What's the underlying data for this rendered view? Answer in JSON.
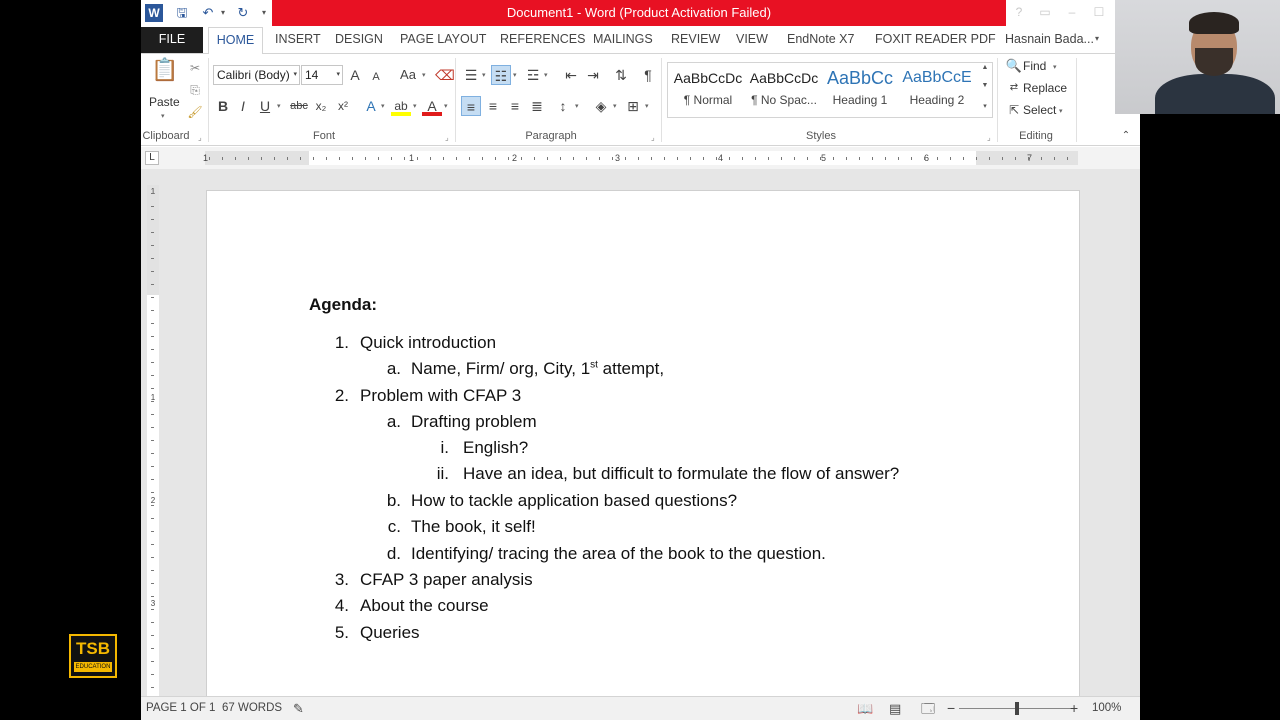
{
  "window": {
    "title": "Document1 -  Word (Product Activation Failed)",
    "help": "?",
    "user_name": "Hasnain Bada..."
  },
  "tabs": [
    {
      "label": "FILE"
    },
    {
      "label": "HOME"
    },
    {
      "label": "INSERT"
    },
    {
      "label": "DESIGN"
    },
    {
      "label": "PAGE LAYOUT"
    },
    {
      "label": "REFERENCES"
    },
    {
      "label": "MAILINGS"
    },
    {
      "label": "REVIEW"
    },
    {
      "label": "VIEW"
    },
    {
      "label": "EndNote X7"
    },
    {
      "label": "FOXIT READER PDF"
    }
  ],
  "ribbon": {
    "clipboard": {
      "paste": "Paste",
      "label": "Clipboard"
    },
    "font": {
      "family": "Calibri (Body)",
      "size": "14",
      "bold": "B",
      "italic": "I",
      "underline": "U",
      "strike": "abc",
      "subscript": "x₂",
      "superscript": "x²",
      "grow": "A",
      "shrink": "A",
      "case": "Aa",
      "label": "Font"
    },
    "paragraph": {
      "label": "Paragraph",
      "pilcrow": "¶"
    },
    "styles": {
      "label": "Styles",
      "items": [
        {
          "sample": "AaBbCcDc",
          "name": "¶ Normal"
        },
        {
          "sample": "AaBbCcDc",
          "name": "¶ No Spac..."
        },
        {
          "sample": "AaBbCc",
          "name": "Heading 1"
        },
        {
          "sample": "AaBbCcE",
          "name": "Heading 2"
        }
      ]
    },
    "editing": {
      "find": "Find",
      "replace": "Replace",
      "select": "Select",
      "label": "Editing"
    }
  },
  "ruler": {
    "numbers": [
      "1",
      "1",
      "2",
      "3",
      "4",
      "5",
      "6",
      "7"
    ]
  },
  "vruler": {
    "numbers": [
      "1",
      "1",
      "2",
      "3"
    ]
  },
  "document": {
    "heading": "Agenda:",
    "lines": [
      {
        "num": "1.",
        "text": "Quick introduction"
      },
      {
        "num": "a.",
        "text": "Name, Firm/ org, City, 1",
        "sup": "st",
        "text_after": " attempt,"
      },
      {
        "num": "2.",
        "text": "Problem with CFAP 3"
      },
      {
        "num": "a.",
        "text": "Drafting problem"
      },
      {
        "num": "i.",
        "text": "English?"
      },
      {
        "num": "ii.",
        "text": "Have an idea, but difficult to formulate the flow of answer?"
      },
      {
        "num": "b.",
        "text": "How to tackle application based questions?"
      },
      {
        "num": "c.",
        "text": "The book, it self!"
      },
      {
        "num": "d.",
        "text": "Identifying/ tracing the area of the book to the question."
      },
      {
        "num": "3.",
        "text": "CFAP 3 paper analysis"
      },
      {
        "num": "4.",
        "text": "About the course"
      },
      {
        "num": "5.",
        "text": "Queries"
      }
    ]
  },
  "status": {
    "page": "PAGE 1 OF 1",
    "words": "67 WORDS",
    "zoom": "100%",
    "zoom_fraction": 0.5
  },
  "logo": {
    "main": "TSB",
    "sub": "EDUCATION"
  }
}
